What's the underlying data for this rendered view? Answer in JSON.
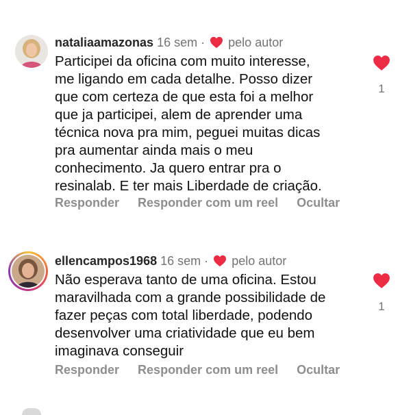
{
  "comments": [
    {
      "username": "nataliaamazonas",
      "time": "16 sem",
      "separator": "·",
      "author_like_label": "pelo autor",
      "text": "Participei da oficina com muito interesse,\nme ligando em cada detalhe.  Posso dizer\nque com certeza de que esta foi a melhor\nque ja participei, alem de aprender uma\ntécnica nova pra mim, peguei muitas dicas\npra aumentar ainda mais o meu\nconhecimento.  Ja quero entrar pra o\nresinalab. E ter mais Liberdade de criação.",
      "like_count": "1",
      "actions": {
        "reply": "Responder",
        "reply_reel": "Responder com um reel",
        "hide": "Ocultar"
      }
    },
    {
      "username": "ellencampos1968",
      "time": "16 sem",
      "separator": "·",
      "author_like_label": "pelo autor",
      "text": "Não esperava tanto de uma oficina. Estou\nmaravilhada com a grande possibilidade de\nfazer peças com  total liberdade, podendo\ndesenvolver uma criatividade que eu bem\nimaginava conseguir",
      "like_count": "1",
      "actions": {
        "reply": "Responder",
        "reply_reel": "Responder com um reel",
        "hide": "Ocultar"
      }
    }
  ],
  "colors": {
    "heart": "#ed2b45",
    "meta_text": "#737373",
    "action_text": "#8e8e8e"
  },
  "icons": {
    "author_heart": "heart-icon",
    "like": "heart-icon"
  }
}
